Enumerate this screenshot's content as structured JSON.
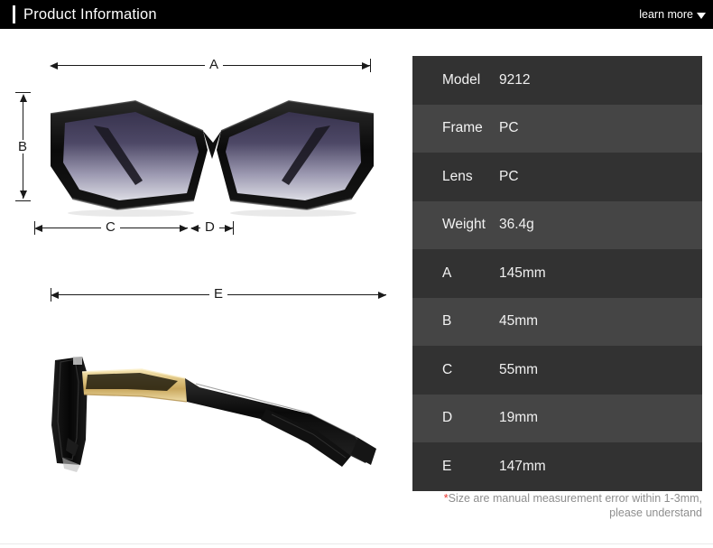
{
  "header": {
    "title": "Product Information",
    "learn_more_label": "learn more",
    "caret_icon": "chevron-down-icon",
    "background": "#000000",
    "accent_color": "#ffffff"
  },
  "diagram": {
    "front_view": {
      "alt": "front view of black cat-eye sunglasses with gradient lenses",
      "frame_color": "#0d0d0d",
      "lens_gradient_top": "#3a3550",
      "lens_gradient_bottom": "#d9d9e2"
    },
    "side_view": {
      "alt": "side view of sunglasses showing gold metal temple and black arm",
      "frame_color": "#0d0d0d",
      "metal_color": "#e3c87f"
    },
    "dimension_labels": {
      "a": "A",
      "b": "B",
      "c": "C",
      "d": "D",
      "e": "E"
    }
  },
  "spec_table": {
    "rows": [
      {
        "label": "Model",
        "value": "9212"
      },
      {
        "label": "Frame",
        "value": "PC"
      },
      {
        "label": "Lens",
        "value": "PC"
      },
      {
        "label": "Weight",
        "value": "36.4g"
      },
      {
        "label": "A",
        "value": "145mm"
      },
      {
        "label": "B",
        "value": "45mm"
      },
      {
        "label": "C",
        "value": "55mm"
      },
      {
        "label": "D",
        "value": "19mm"
      },
      {
        "label": "E",
        "value": "147mm"
      }
    ],
    "row_color_odd": "#323232",
    "row_color_even": "#454545"
  },
  "note": {
    "star": "*",
    "line1": "Size are manual measurement error within 1-3mm,",
    "line2": "please understand",
    "star_color": "#e8352e"
  }
}
